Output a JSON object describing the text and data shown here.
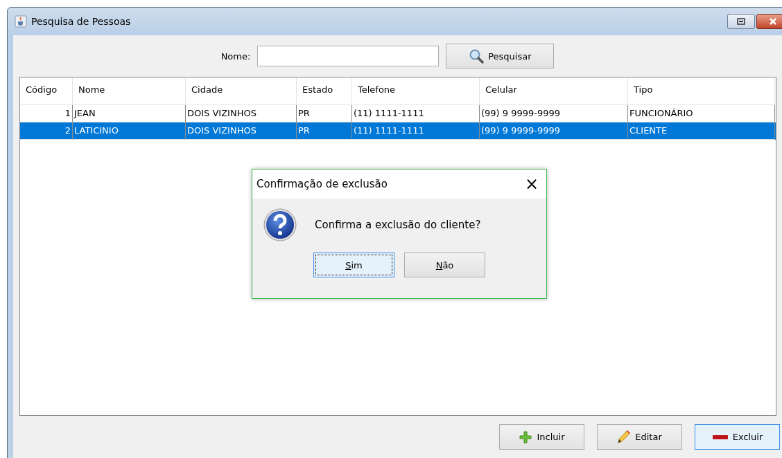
{
  "window": {
    "title": "Pesquisa de Pessoas"
  },
  "search": {
    "label": "Nome:",
    "button": "Pesquisar"
  },
  "table": {
    "columns": [
      {
        "label": "Código",
        "numeric": true
      },
      {
        "label": "Nome",
        "numeric": false
      },
      {
        "label": "Cidade",
        "numeric": false
      },
      {
        "label": "Estado",
        "numeric": false
      },
      {
        "label": "Telefone",
        "numeric": false
      },
      {
        "label": "Celular",
        "numeric": false
      },
      {
        "label": "Tipo",
        "numeric": false
      }
    ],
    "rows": [
      {
        "selected": false,
        "cells": [
          "1",
          "JEAN",
          "DOIS VIZINHOS",
          "PR",
          "(11) 1111-1111",
          "(99) 9 9999-9999",
          "FUNCIONÁRIO"
        ]
      },
      {
        "selected": true,
        "cells": [
          "2",
          "LATICINIO",
          "DOIS VIZINHOS",
          "PR",
          "(11) 1111-1111",
          "(99) 9 9999-9999",
          "CLIENTE"
        ]
      }
    ]
  },
  "actions": [
    {
      "kind": "add",
      "label": "Incluir",
      "focused": false
    },
    {
      "kind": "edit",
      "label": "Editar",
      "focused": false
    },
    {
      "kind": "delete",
      "label": "Excluir",
      "focused": true
    }
  ],
  "dialog": {
    "title": "Confirmação de exclusão",
    "close": "×",
    "message": "Confirma a exclusão do cliente?",
    "buttons": [
      {
        "label": "Sim",
        "focused": true
      },
      {
        "label": "Não",
        "focused": false
      }
    ]
  }
}
